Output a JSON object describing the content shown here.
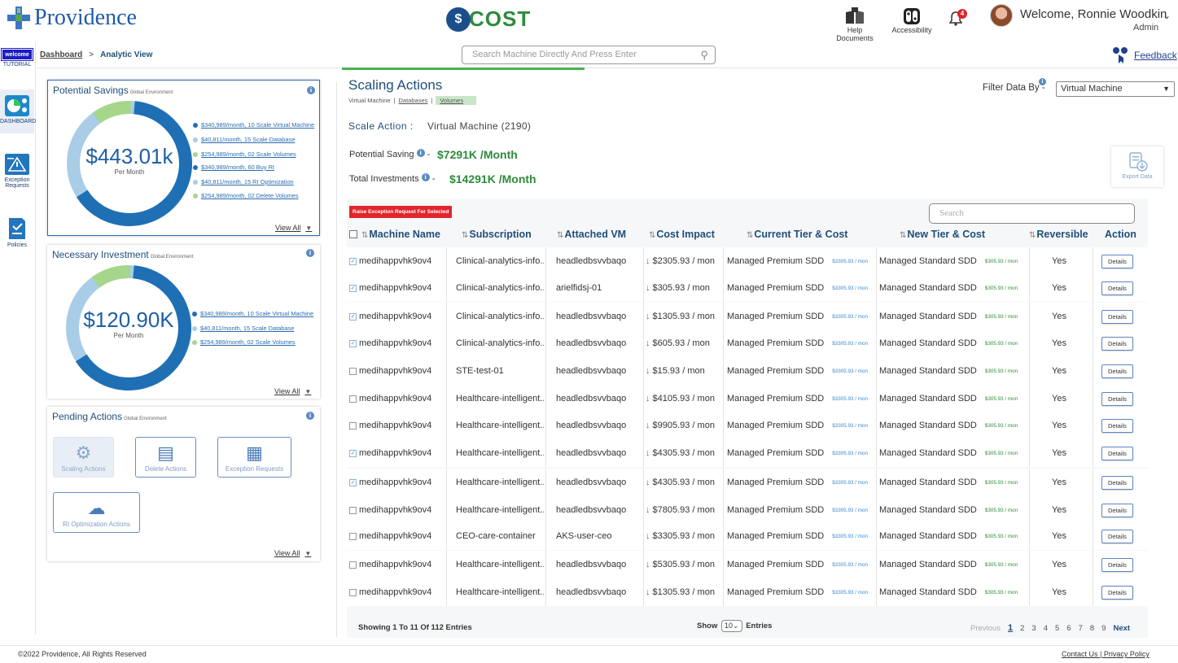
{
  "header": {
    "brand": "Providence",
    "app_logo_text": "COST",
    "help_label": "Help Documents",
    "accessibility_label": "Accessibility",
    "notification_count": "4",
    "welcome": "Welcome, Ronnie Woodkin",
    "role": "Admin"
  },
  "sidebar": {
    "items": [
      {
        "label": "TUTORIAL",
        "badge": "welcome",
        "icon": "welcome-icon"
      },
      {
        "label": "DASHBOARD",
        "icon": "dashboard-icon"
      },
      {
        "label": "Exception Requests",
        "icon": "exception-icon"
      },
      {
        "label": "Policies",
        "icon": "policies-icon"
      }
    ]
  },
  "breadcrumb": {
    "root": "Dashboard",
    "sep": ">",
    "current": "Analytic View"
  },
  "search": {
    "placeholder": "Search Machine Directly And Press Enter"
  },
  "feedback": "Feedback",
  "potential_savings": {
    "title": "Potential Savings",
    "scope": "Global Environment",
    "total": "$443.01k",
    "unit": "Per Month",
    "legend": [
      {
        "text": "$340,989/month, 10 Scale Virtual Machine",
        "color": "#1f6fb5"
      },
      {
        "text": "$40,811/month, 15 Scale Database",
        "color": "#a9cde6"
      },
      {
        "text": "$254,989/month, 02 Scale Volumes",
        "color": "#a6d68a"
      },
      {
        "text": "$340,989/month, 60 Buy RI",
        "color": "#1f6fb5"
      },
      {
        "text": "$40,811/month, 15 RI Optimization",
        "color": "#a9cde6"
      },
      {
        "text": "$254,989/month, 02 Delete Volumes",
        "color": "#a6d68a"
      }
    ],
    "view_all": "View All"
  },
  "necessary_investment": {
    "title": "Necessary Investment",
    "scope": "Global Environment",
    "total": "$120.90K",
    "unit": "Per Month",
    "legend": [
      {
        "text": "$340,989/month, 10 Scale Virtual Machine",
        "color": "#1f6fb5"
      },
      {
        "text": "$40,811/month, 15 Scale Database",
        "color": "#a9cde6"
      },
      {
        "text": "$254,989/month, 02 Scale Volumes",
        "color": "#a6d68a"
      }
    ],
    "view_all": "View All"
  },
  "pending_actions": {
    "title": "Pending Actions",
    "scope": "Global Environment",
    "buttons": [
      "Scaling Actions",
      "Delete Actions",
      "Exception Requests",
      "RI Optimization Actions"
    ],
    "view_all": "View All"
  },
  "scaling": {
    "title": "Scaling Actions",
    "tabs": [
      "Virtual Machine",
      "Databases",
      "Volumes"
    ],
    "filter_label": "Filter Data By",
    "filter_value": "Virtual Machine",
    "scale_action_label": "Scale Action :",
    "scale_action_value": "Virtual Machine (2190)",
    "potential_saving_label": "Potential Saving",
    "potential_saving_value": "$7291K /Month",
    "total_investments_label": "Total Investments",
    "total_investments_value": "$14291K /Month",
    "export_label": "Export Data"
  },
  "table": {
    "raise_button": "Raise Exception Request For Selected",
    "search_placeholder": "Search",
    "columns": [
      "Machine Name",
      "Subscription",
      "Attached VM",
      "Cost Impact",
      "Current Tier & Cost",
      "New Tier & Cost",
      "Reversible",
      "Action"
    ],
    "rows": [
      {
        "checked": true,
        "name": "medihappvhk9ov4",
        "sub": "Clinical-analytics-info..",
        "vm": "headledbsvvbaqo",
        "impact": "$2305.93 / mon",
        "cur": "Managed Premium SDD",
        "cur_cost": "$3305.93 / mon",
        "new": "Managed Standard SDD",
        "new_cost": "$305.93 / mon",
        "rev": "Yes",
        "action": "Details"
      },
      {
        "checked": true,
        "name": "medihappvhk9ov4",
        "sub": "Clinical-analytics-info..",
        "vm": "arielfidsj-01",
        "impact": "$305.93 / mon",
        "cur": "Managed Premium SDD",
        "cur_cost": "$3305.93 / mon",
        "new": "Managed Standard SDD",
        "new_cost": "$305.93 / mon",
        "rev": "Yes",
        "action": "Details"
      },
      {
        "checked": true,
        "name": "medihappvhk9ov4",
        "sub": "Clinical-analytics-info..",
        "vm": "headledbsvvbaqo",
        "impact": "$1305.93 / mon",
        "cur": "Managed Premium SDD",
        "cur_cost": "$3305.93 / mon",
        "new": "Managed Standard SDD",
        "new_cost": "$305.93 / mon",
        "rev": "Yes",
        "action": "Details"
      },
      {
        "checked": true,
        "name": "medihappvhk9ov4",
        "sub": "Clinical-analytics-info..",
        "vm": "headledbsvvbaqo",
        "impact": "$605.93 / mon",
        "cur": "Managed Premium SDD",
        "cur_cost": "$3305.93 / mon",
        "new": "Managed Standard SDD",
        "new_cost": "$305.93 / mon",
        "rev": "Yes",
        "action": "Details"
      },
      {
        "checked": false,
        "name": "medihappvhk9ov4",
        "sub": "STE-test-01",
        "vm": "headledbsvvbaqo",
        "impact": "$15.93 / mon",
        "cur": "Managed Premium SDD",
        "cur_cost": "$3305.93 / mon",
        "new": "Managed Standard SDD",
        "new_cost": "$305.93 / mon",
        "rev": "Yes",
        "action": "Details"
      },
      {
        "checked": false,
        "name": "medihappvhk9ov4",
        "sub": "Healthcare-intelligent..",
        "vm": "headledbsvvbaqo",
        "impact": "$4105.93 / mon",
        "cur": "Managed Premium SDD",
        "cur_cost": "$3305.93 / mon",
        "new": "Managed Standard SDD",
        "new_cost": "$305.93 / mon",
        "rev": "Yes",
        "action": "Details"
      },
      {
        "checked": false,
        "name": "medihappvhk9ov4",
        "sub": "Healthcare-intelligent..",
        "vm": "headledbsvvbaqo",
        "impact": "$9905.93 / mon",
        "cur": "Managed Premium SDD",
        "cur_cost": "$3305.93 / mon",
        "new": "Managed Standard SDD",
        "new_cost": "$305.93 / mon",
        "rev": "Yes",
        "action": "Details"
      },
      {
        "checked": true,
        "name": "medihappvhk9ov4",
        "sub": "Healthcare-intelligent..",
        "vm": "headledbsvvbaqo",
        "impact": "$4305.93 / mon",
        "cur": "Managed Premium SDD",
        "cur_cost": "$3305.93 / mon",
        "new": "Managed Standard SDD",
        "new_cost": "$305.93 / mon",
        "rev": "Yes",
        "action": "Details"
      },
      {
        "checked": true,
        "name": "medihappvhk9ov4",
        "sub": "Healthcare-intelligent..",
        "vm": "headledbsvvbaqo",
        "impact": "$4305.93 / mon",
        "cur": "Managed Premium SDD",
        "cur_cost": "$3305.93 / mon",
        "new": "Managed Standard SDD",
        "new_cost": "$305.93 / mon",
        "rev": "Yes",
        "action": "Details"
      },
      {
        "checked": false,
        "name": "medihappvhk9ov4",
        "sub": "Healthcare-intelligent..",
        "vm": "headledbsvvbaqo",
        "impact": "$7805.93 / mon",
        "cur": "Managed Premium SDD",
        "cur_cost": "$3305.93 / mon",
        "new": "Managed Standard SDD",
        "new_cost": "$305.93 / mon",
        "rev": "Yes",
        "action": "Details"
      },
      {
        "checked": false,
        "name": "medihappvhk9ov4",
        "sub": "CEO-care-container",
        "vm": "AKS-user-ceo",
        "impact": "$3305.93 / mon",
        "cur": "Managed Premium SDD",
        "cur_cost": "$3305.93 / mon",
        "new": "Managed Standard SDD",
        "new_cost": "$305.93 / mon",
        "rev": "Yes",
        "action": "Details"
      },
      {
        "checked": false,
        "name": "medihappvhk9ov4",
        "sub": "Healthcare-intelligent..",
        "vm": "headledbsvvbaqo",
        "impact": "$5305.93 / mon",
        "cur": "Managed Premium SDD",
        "cur_cost": "$3305.93 / mon",
        "new": "Managed Standard SDD",
        "new_cost": "$305.93 / mon",
        "rev": "Yes",
        "action": "Details"
      },
      {
        "checked": false,
        "name": "medihappvhk9ov4",
        "sub": "Healthcare-intelligent..",
        "vm": "headledbsvvbaqo",
        "impact": "$1305.93 / mon",
        "cur": "Managed Premium SDD",
        "cur_cost": "$3305.93 / mon",
        "new": "Managed Standard SDD",
        "new_cost": "$305.93 / mon",
        "rev": "Yes",
        "action": "Details"
      }
    ],
    "entries_text": "Showing 1 To 11 Of 112 Entries",
    "show_label": "Show",
    "show_value": "10",
    "entries_label": "Entries",
    "pager": {
      "prev": "Previous",
      "pages": [
        "1",
        "2",
        "3",
        "4",
        "5",
        "6",
        "7",
        "8",
        "9"
      ],
      "next": "Next"
    }
  },
  "footer": {
    "copyright": "2022 Providence, All Rights Reserved",
    "links": "Contact Us | Privacy Policy"
  }
}
